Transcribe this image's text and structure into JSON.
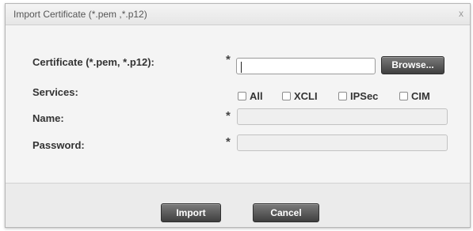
{
  "dialog": {
    "title": "Import Certificate (*.pem ,*.p12)",
    "close_label": "x"
  },
  "form": {
    "certificate": {
      "label": "Certificate (*.pem, *.p12):",
      "required_mark": "*",
      "value": "",
      "browse_label": "Browse..."
    },
    "services": {
      "label": "Services:",
      "options": [
        {
          "label": "All",
          "checked": false
        },
        {
          "label": "XCLI",
          "checked": false
        },
        {
          "label": "IPSec",
          "checked": false
        },
        {
          "label": "CIM",
          "checked": false
        }
      ]
    },
    "name": {
      "label": "Name:",
      "required_mark": "*",
      "value": ""
    },
    "password": {
      "label": "Password:",
      "required_mark": "*",
      "value": ""
    }
  },
  "footer": {
    "import_label": "Import",
    "cancel_label": "Cancel"
  }
}
